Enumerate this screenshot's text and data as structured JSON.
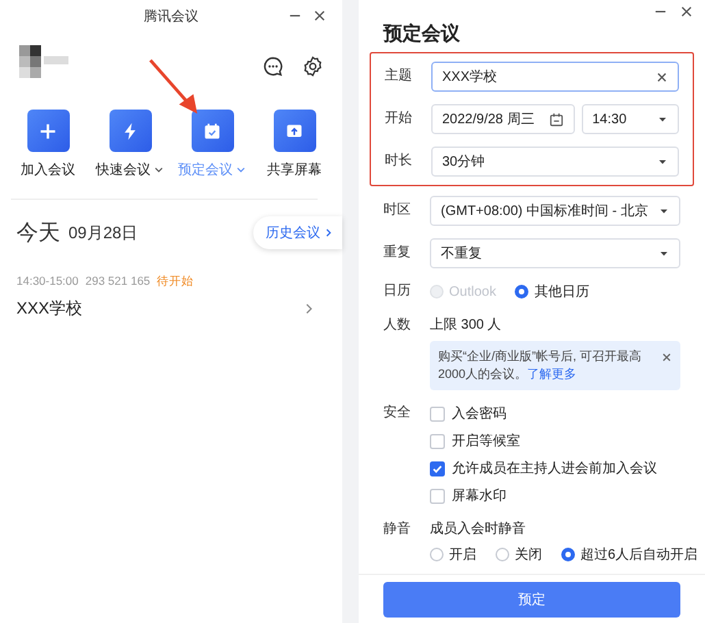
{
  "left_window": {
    "title": "腾讯会议",
    "actions": [
      {
        "label": "加入会议",
        "kind": "plus",
        "dropdown": false,
        "selected": false
      },
      {
        "label": "快速会议",
        "kind": "bolt",
        "dropdown": true,
        "selected": false
      },
      {
        "label": "预定会议",
        "kind": "calendar",
        "dropdown": true,
        "selected": true
      },
      {
        "label": "共享屏幕",
        "kind": "share",
        "dropdown": false,
        "selected": false
      }
    ],
    "today": {
      "label": "今天",
      "date": "09月28日"
    },
    "history_button": "历史会议",
    "meetings": [
      {
        "time": "14:30-15:00",
        "number": "293 521 165",
        "status": "待开始",
        "title": "XXX学校"
      }
    ]
  },
  "right_window": {
    "title": "预定会议",
    "field_groups": [
      {
        "highlighted": true,
        "fields": [
          {
            "kind": "text",
            "label": "主题",
            "value": "XXX学校"
          },
          {
            "kind": "datetime",
            "label": "开始",
            "date": "2022/9/28 周三",
            "time": "14:30"
          },
          {
            "kind": "select",
            "label": "时长",
            "value": "30分钟"
          }
        ]
      },
      {
        "highlighted": false,
        "fields": [
          {
            "kind": "select",
            "label": "时区",
            "value": "(GMT+08:00) 中国标准时间 - 北京"
          },
          {
            "kind": "select",
            "label": "重复",
            "value": "不重复"
          },
          {
            "kind": "radio",
            "label": "日历",
            "options": [
              {
                "label": "Outlook",
                "selected": false,
                "disabled": true
              },
              {
                "label": "其他日历",
                "selected": true,
                "disabled": false
              }
            ]
          },
          {
            "kind": "info",
            "label": "人数",
            "value": "上限 300 人",
            "notice": {
              "text": "购买“企业/商业版”帐号后, 可召开最高2000人的会议。",
              "link": "了解更多"
            }
          },
          {
            "kind": "checkboxes",
            "label": "安全",
            "options": [
              {
                "label": "入会密码",
                "checked": false
              },
              {
                "label": "开启等候室",
                "checked": false
              },
              {
                "label": "允许成员在主持人进会前加入会议",
                "checked": true
              },
              {
                "label": "屏幕水印",
                "checked": false
              }
            ]
          },
          {
            "kind": "mute",
            "label": "静音",
            "value": "成员入会时静音",
            "options": [
              {
                "label": "开启",
                "selected": false,
                "disabled": false
              },
              {
                "label": "关闭",
                "selected": false,
                "disabled": false
              },
              {
                "label": "超过6人后自动开启",
                "selected": true,
                "disabled": false
              }
            ]
          }
        ]
      }
    ],
    "submit_button": "预定"
  }
}
